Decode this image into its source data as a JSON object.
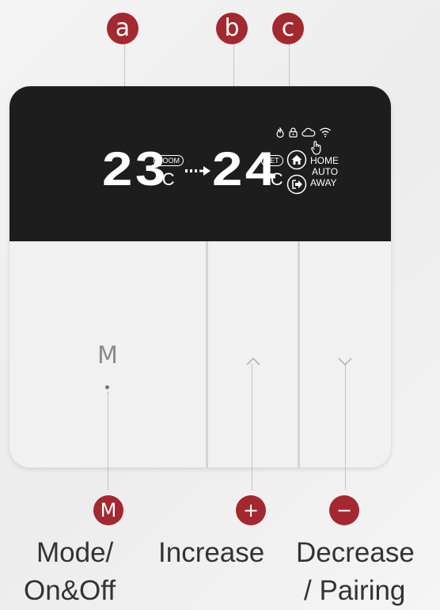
{
  "callouts": {
    "a": "a",
    "b": "b",
    "c": "c",
    "mode": "M",
    "increase": "+",
    "decrease": "−"
  },
  "display": {
    "room_temp": "23",
    "set_temp": "24",
    "unit": "°C",
    "room_label": "ROOM",
    "set_label": "SET",
    "modes": [
      "HOME",
      "AUTO",
      "AWAY"
    ],
    "status_icons": [
      "flame-icon",
      "lock-icon",
      "cloud-icon",
      "wifi-icon",
      "hand-icon"
    ]
  },
  "keys": {
    "mode_letter": "M"
  },
  "captions": {
    "mode": [
      "Mode/",
      "On&Off"
    ],
    "increase": "Increase",
    "decrease": [
      "Decrease",
      "/ Pairing"
    ]
  },
  "colors": {
    "accent": "#a3282f",
    "screen": "#1d1d1d",
    "device": "#f1f1f1"
  }
}
